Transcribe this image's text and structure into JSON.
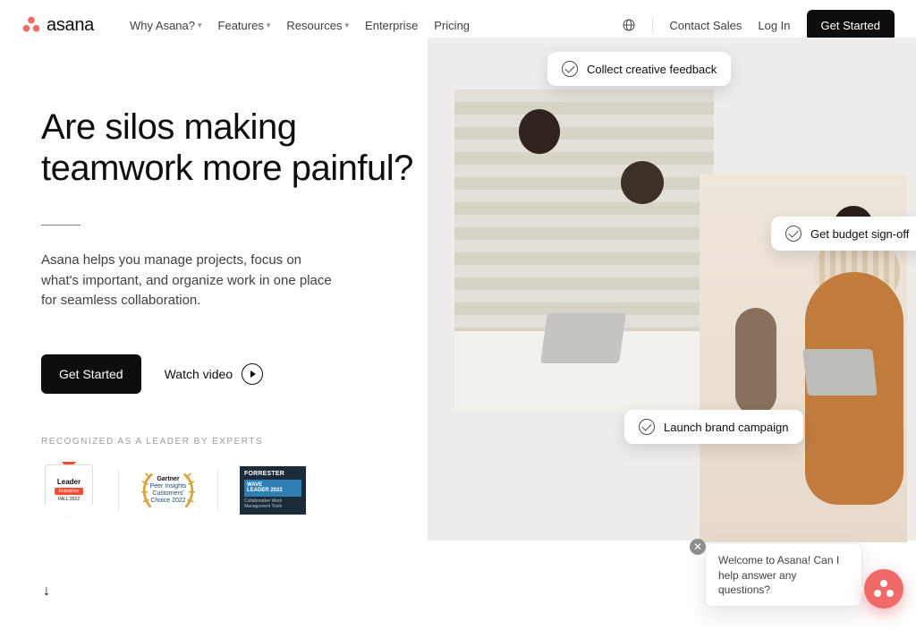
{
  "brand": {
    "name": "asana"
  },
  "nav": {
    "items": [
      {
        "label": "Why Asana?",
        "caret": true
      },
      {
        "label": "Features",
        "caret": true
      },
      {
        "label": "Resources",
        "caret": true
      },
      {
        "label": "Enterprise",
        "caret": false
      },
      {
        "label": "Pricing",
        "caret": false
      }
    ],
    "contact": "Contact Sales",
    "login": "Log In",
    "cta": "Get Started"
  },
  "hero": {
    "headline": "Are silos making teamwork more painful?",
    "subhead": "Asana helps you manage projects, focus on what's important, and organize work in one place for seamless collaboration.",
    "cta": "Get Started",
    "watch": "Watch video",
    "eyebrow": "RECOGNIZED AS A LEADER BY EXPERTS"
  },
  "badges": {
    "g2": {
      "title": "Leader",
      "tag": "Enterprise",
      "period": "FALL 2022"
    },
    "gartner": {
      "brand": "Gartner",
      "line1": "Peer Insights",
      "line2": "Customers'",
      "line3": "Choice 2022"
    },
    "forrester": {
      "brand": "FORRESTER",
      "wave1": "WAVE",
      "wave2": "LEADER 2022",
      "sub": "Collaborative Work Management Tools"
    }
  },
  "tasks": {
    "a": "Collect creative feedback",
    "b": "Get budget sign-off",
    "c": "Launch brand campaign"
  },
  "chat": {
    "greeting": "Welcome to Asana! Can I help answer any questions?"
  }
}
